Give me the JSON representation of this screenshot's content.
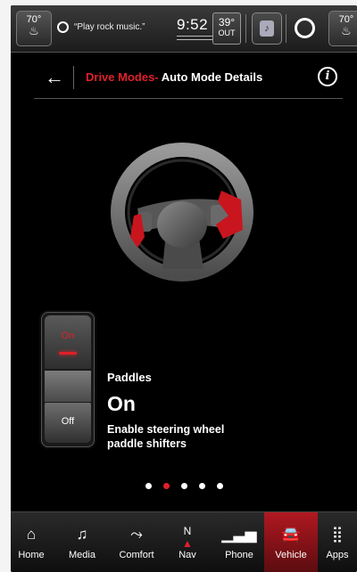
{
  "status_bar": {
    "left_temp": "70°",
    "right_temp": "70°",
    "voice_text": "“Play rock music.”",
    "time": "9:52",
    "outside_temp": "39°",
    "outside_label": "OUT"
  },
  "header": {
    "back_label": "←",
    "title_section": "Drive Modes-",
    "title_page": "Auto Mode Details",
    "info_label": "i"
  },
  "toggle": {
    "on_label": "On",
    "off_label": "Off",
    "state": "on"
  },
  "feature": {
    "name": "Paddles",
    "state": "On",
    "description": "Enable steering wheel paddle shifters"
  },
  "pagination": {
    "count": 5,
    "active_index": 1
  },
  "nav": {
    "items": [
      {
        "label": "Home",
        "icon": "home-icon"
      },
      {
        "label": "Media",
        "icon": "music-note-icon"
      },
      {
        "label": "Comfort",
        "icon": "seat-comfort-icon"
      },
      {
        "label": "Nav",
        "icon": "compass-icon"
      },
      {
        "label": "Phone",
        "icon": "signal-phone-icon"
      },
      {
        "label": "Vehicle",
        "icon": "car-icon",
        "active": true
      },
      {
        "label": "Apps",
        "icon": "apps-grid-icon"
      }
    ]
  },
  "colors": {
    "accent": "#e0202a",
    "background": "#000000"
  }
}
